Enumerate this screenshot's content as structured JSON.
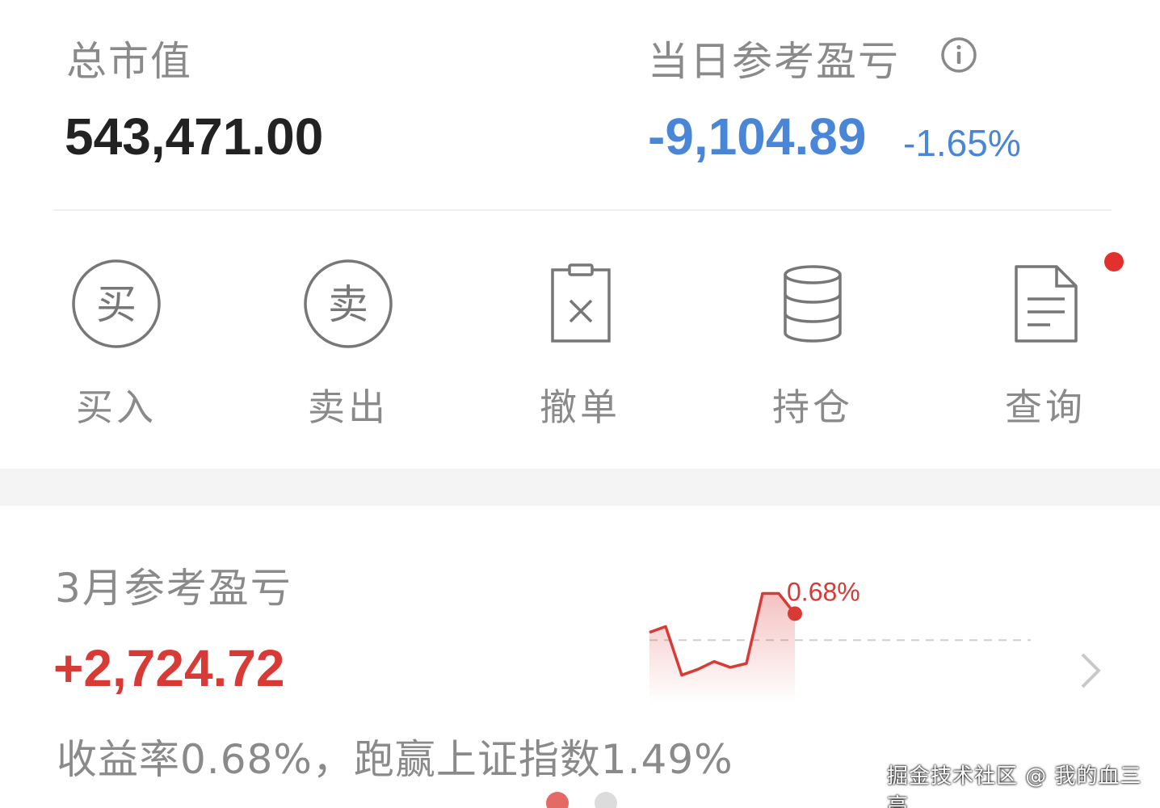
{
  "summary": {
    "total_label": "总市值",
    "total_value": "543,471.00",
    "daily_label": "当日参考盈亏",
    "daily_value": "-9,104.89",
    "daily_pct": "-1.65%"
  },
  "actions": [
    {
      "label": "买入",
      "icon_char": "买",
      "icon": "buy-circle-icon"
    },
    {
      "label": "卖出",
      "icon_char": "卖",
      "icon": "sell-circle-icon"
    },
    {
      "label": "撤单",
      "icon": "clipboard-cancel-icon"
    },
    {
      "label": "持仓",
      "icon": "database-stack-icon"
    },
    {
      "label": "查询",
      "icon": "document-lines-icon"
    }
  ],
  "monthly": {
    "title": "3月参考盈亏",
    "value": "+2,724.72",
    "description": "收益率0.68%，跑赢上证指数1.49%"
  },
  "chart_data": {
    "type": "line",
    "values": [
      0.2,
      0.35,
      -0.9,
      -0.75,
      -0.55,
      -0.7,
      -0.6,
      1.2,
      1.2,
      0.68
    ],
    "annotation": "0.68%",
    "baseline": 0,
    "ylim": [
      -1.2,
      1.5
    ]
  },
  "pager": {
    "active_index": 0,
    "count": 2
  },
  "colors": {
    "loss": "#4a86d8",
    "gain": "#d83a36",
    "muted": "#8a8a8a",
    "value": "#222222"
  },
  "watermark": "掘金技术社区 @ 我的血三高"
}
